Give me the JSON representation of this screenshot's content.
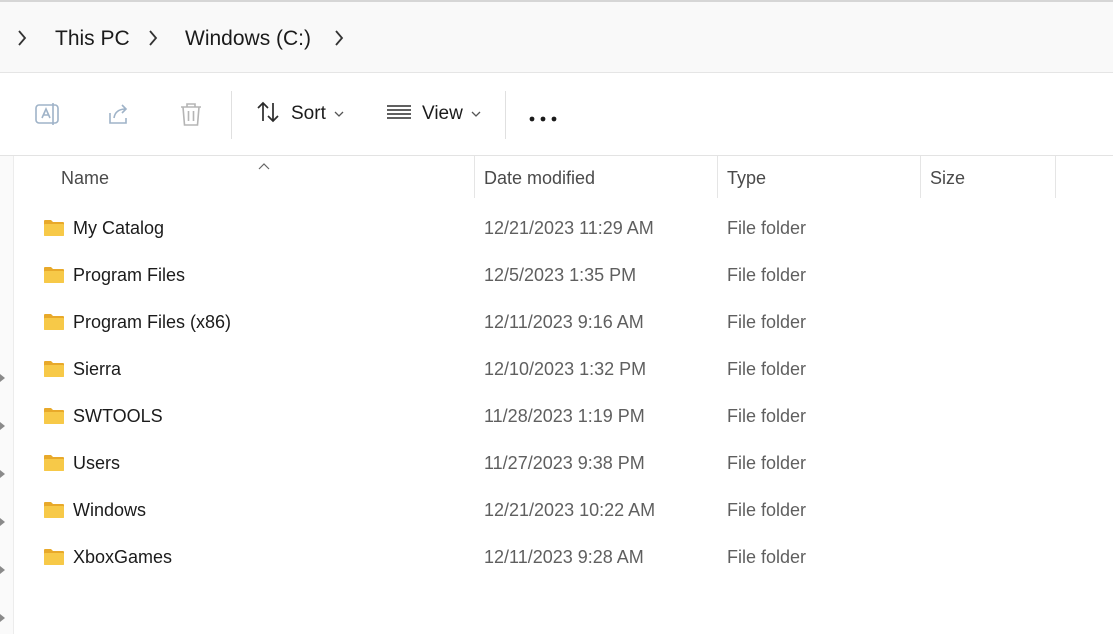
{
  "breadcrumb": {
    "items": [
      "This PC",
      "Windows (C:)"
    ]
  },
  "toolbar": {
    "rename_icon": "rename-icon",
    "share_icon": "share-icon",
    "delete_icon": "trash-icon",
    "sort_label": "Sort",
    "view_label": "View",
    "more_icon": "more-icon"
  },
  "columns": {
    "name": "Name",
    "date": "Date modified",
    "type": "Type",
    "size": "Size"
  },
  "files": [
    {
      "name": "My Catalog",
      "date": "12/21/2023 11:29 AM",
      "type": "File folder",
      "size": ""
    },
    {
      "name": "Program Files",
      "date": "12/5/2023 1:35 PM",
      "type": "File folder",
      "size": ""
    },
    {
      "name": "Program Files (x86)",
      "date": "12/11/2023 9:16 AM",
      "type": "File folder",
      "size": ""
    },
    {
      "name": "Sierra",
      "date": "12/10/2023 1:32 PM",
      "type": "File folder",
      "size": ""
    },
    {
      "name": "SWTOOLS",
      "date": "11/28/2023 1:19 PM",
      "type": "File folder",
      "size": ""
    },
    {
      "name": "Users",
      "date": "11/27/2023 9:38 PM",
      "type": "File folder",
      "size": ""
    },
    {
      "name": "Windows",
      "date": "12/21/2023 10:22 AM",
      "type": "File folder",
      "size": ""
    },
    {
      "name": "XboxGames",
      "date": "12/11/2023 9:28 AM",
      "type": "File folder",
      "size": ""
    }
  ],
  "colors": {
    "folder": "#f7c948",
    "folder_dark": "#e8a92a",
    "icon_disabled": "#9fb3c8"
  }
}
